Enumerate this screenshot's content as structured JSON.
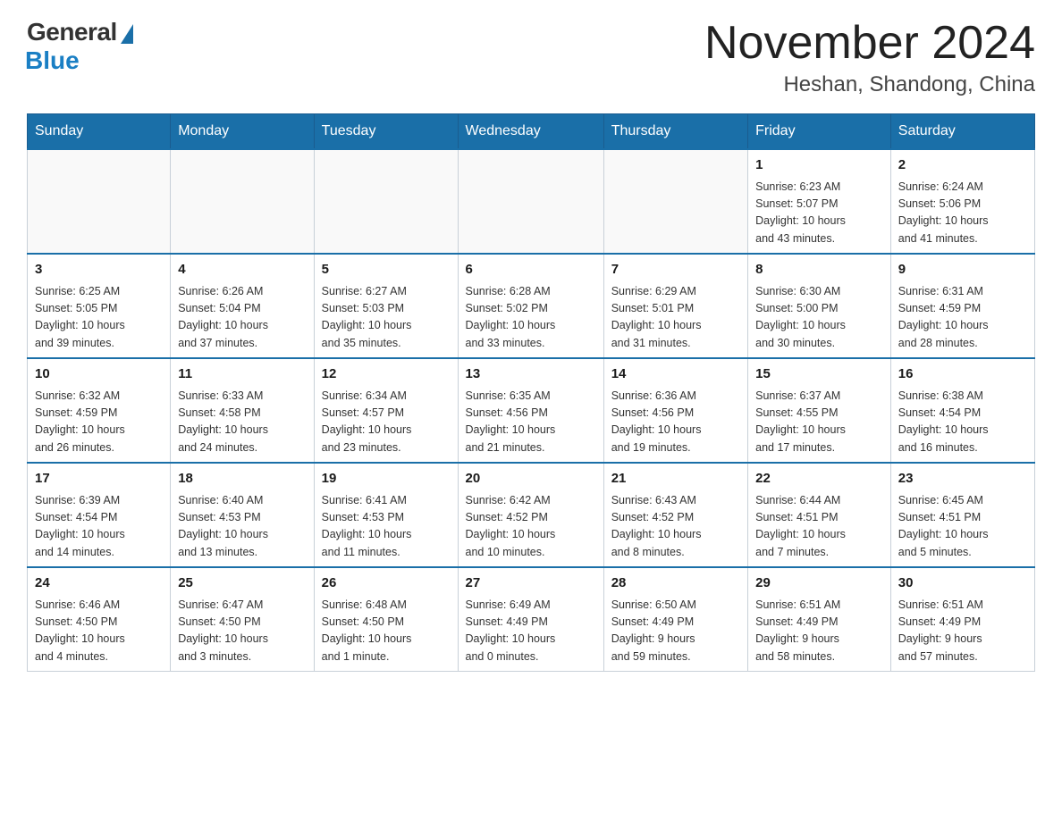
{
  "header": {
    "logo_general": "General",
    "logo_blue": "Blue",
    "month_title": "November 2024",
    "location": "Heshan, Shandong, China"
  },
  "weekdays": [
    "Sunday",
    "Monday",
    "Tuesday",
    "Wednesday",
    "Thursday",
    "Friday",
    "Saturday"
  ],
  "weeks": [
    [
      {
        "day": "",
        "info": ""
      },
      {
        "day": "",
        "info": ""
      },
      {
        "day": "",
        "info": ""
      },
      {
        "day": "",
        "info": ""
      },
      {
        "day": "",
        "info": ""
      },
      {
        "day": "1",
        "info": "Sunrise: 6:23 AM\nSunset: 5:07 PM\nDaylight: 10 hours\nand 43 minutes."
      },
      {
        "day": "2",
        "info": "Sunrise: 6:24 AM\nSunset: 5:06 PM\nDaylight: 10 hours\nand 41 minutes."
      }
    ],
    [
      {
        "day": "3",
        "info": "Sunrise: 6:25 AM\nSunset: 5:05 PM\nDaylight: 10 hours\nand 39 minutes."
      },
      {
        "day": "4",
        "info": "Sunrise: 6:26 AM\nSunset: 5:04 PM\nDaylight: 10 hours\nand 37 minutes."
      },
      {
        "day": "5",
        "info": "Sunrise: 6:27 AM\nSunset: 5:03 PM\nDaylight: 10 hours\nand 35 minutes."
      },
      {
        "day": "6",
        "info": "Sunrise: 6:28 AM\nSunset: 5:02 PM\nDaylight: 10 hours\nand 33 minutes."
      },
      {
        "day": "7",
        "info": "Sunrise: 6:29 AM\nSunset: 5:01 PM\nDaylight: 10 hours\nand 31 minutes."
      },
      {
        "day": "8",
        "info": "Sunrise: 6:30 AM\nSunset: 5:00 PM\nDaylight: 10 hours\nand 30 minutes."
      },
      {
        "day": "9",
        "info": "Sunrise: 6:31 AM\nSunset: 4:59 PM\nDaylight: 10 hours\nand 28 minutes."
      }
    ],
    [
      {
        "day": "10",
        "info": "Sunrise: 6:32 AM\nSunset: 4:59 PM\nDaylight: 10 hours\nand 26 minutes."
      },
      {
        "day": "11",
        "info": "Sunrise: 6:33 AM\nSunset: 4:58 PM\nDaylight: 10 hours\nand 24 minutes."
      },
      {
        "day": "12",
        "info": "Sunrise: 6:34 AM\nSunset: 4:57 PM\nDaylight: 10 hours\nand 23 minutes."
      },
      {
        "day": "13",
        "info": "Sunrise: 6:35 AM\nSunset: 4:56 PM\nDaylight: 10 hours\nand 21 minutes."
      },
      {
        "day": "14",
        "info": "Sunrise: 6:36 AM\nSunset: 4:56 PM\nDaylight: 10 hours\nand 19 minutes."
      },
      {
        "day": "15",
        "info": "Sunrise: 6:37 AM\nSunset: 4:55 PM\nDaylight: 10 hours\nand 17 minutes."
      },
      {
        "day": "16",
        "info": "Sunrise: 6:38 AM\nSunset: 4:54 PM\nDaylight: 10 hours\nand 16 minutes."
      }
    ],
    [
      {
        "day": "17",
        "info": "Sunrise: 6:39 AM\nSunset: 4:54 PM\nDaylight: 10 hours\nand 14 minutes."
      },
      {
        "day": "18",
        "info": "Sunrise: 6:40 AM\nSunset: 4:53 PM\nDaylight: 10 hours\nand 13 minutes."
      },
      {
        "day": "19",
        "info": "Sunrise: 6:41 AM\nSunset: 4:53 PM\nDaylight: 10 hours\nand 11 minutes."
      },
      {
        "day": "20",
        "info": "Sunrise: 6:42 AM\nSunset: 4:52 PM\nDaylight: 10 hours\nand 10 minutes."
      },
      {
        "day": "21",
        "info": "Sunrise: 6:43 AM\nSunset: 4:52 PM\nDaylight: 10 hours\nand 8 minutes."
      },
      {
        "day": "22",
        "info": "Sunrise: 6:44 AM\nSunset: 4:51 PM\nDaylight: 10 hours\nand 7 minutes."
      },
      {
        "day": "23",
        "info": "Sunrise: 6:45 AM\nSunset: 4:51 PM\nDaylight: 10 hours\nand 5 minutes."
      }
    ],
    [
      {
        "day": "24",
        "info": "Sunrise: 6:46 AM\nSunset: 4:50 PM\nDaylight: 10 hours\nand 4 minutes."
      },
      {
        "day": "25",
        "info": "Sunrise: 6:47 AM\nSunset: 4:50 PM\nDaylight: 10 hours\nand 3 minutes."
      },
      {
        "day": "26",
        "info": "Sunrise: 6:48 AM\nSunset: 4:50 PM\nDaylight: 10 hours\nand 1 minute."
      },
      {
        "day": "27",
        "info": "Sunrise: 6:49 AM\nSunset: 4:49 PM\nDaylight: 10 hours\nand 0 minutes."
      },
      {
        "day": "28",
        "info": "Sunrise: 6:50 AM\nSunset: 4:49 PM\nDaylight: 9 hours\nand 59 minutes."
      },
      {
        "day": "29",
        "info": "Sunrise: 6:51 AM\nSunset: 4:49 PM\nDaylight: 9 hours\nand 58 minutes."
      },
      {
        "day": "30",
        "info": "Sunrise: 6:51 AM\nSunset: 4:49 PM\nDaylight: 9 hours\nand 57 minutes."
      }
    ]
  ]
}
